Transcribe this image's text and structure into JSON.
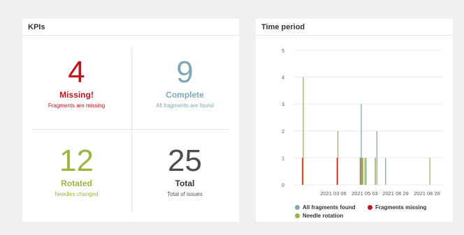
{
  "kpi_panel": {
    "title": "KPIs",
    "cells": [
      {
        "number": "4",
        "label": "Missing!",
        "sub": "Fragments are missing",
        "color": "#c0141e"
      },
      {
        "number": "9",
        "label": "Complete",
        "sub": "All fragments are found",
        "color": "#7fa7b6"
      },
      {
        "number": "12",
        "label": "Rotated",
        "sub": "Needles changed",
        "color": "#9ab642"
      },
      {
        "number": "25",
        "label": "Total",
        "sub": "Total of issues",
        "color": "#4d4d4d"
      }
    ]
  },
  "time_panel": {
    "title": "Time period"
  },
  "chart_data": {
    "type": "bar",
    "title": "",
    "ylim": [
      0,
      5
    ],
    "yticks": [
      "0",
      "1",
      "2",
      "3",
      "4",
      "5"
    ],
    "xticks": [
      "2021 03 06",
      "2021 05 03",
      "2021 06 29",
      "2021 08 26"
    ],
    "grid": true,
    "legend_position": "bottom",
    "series": [
      {
        "name": "All fragments found",
        "color": "#7fa7b6",
        "points": [
          {
            "date": "2021-04-28",
            "value": 3
          },
          {
            "date": "2021-05-07",
            "value": 1
          },
          {
            "date": "2021-05-24",
            "value": 1
          },
          {
            "date": "2021-05-27",
            "value": 2
          },
          {
            "date": "2021-06-12",
            "value": 1
          }
        ]
      },
      {
        "name": "Fragments missing",
        "color": "#c0141e",
        "points": [
          {
            "date": "2021-01-08",
            "value": 1
          },
          {
            "date": "2021-03-13",
            "value": 1
          },
          {
            "date": "2021-04-25",
            "value": 1
          },
          {
            "date": "2021-04-29",
            "value": 1
          }
        ]
      },
      {
        "name": "Needle rotation",
        "color": "#9ab642",
        "points": [
          {
            "date": "2021-01-08",
            "value": 4
          },
          {
            "date": "2021-03-13",
            "value": 2
          },
          {
            "date": "2021-04-23",
            "value": 1
          },
          {
            "date": "2021-04-26",
            "value": 1
          },
          {
            "date": "2021-04-27",
            "value": 1
          },
          {
            "date": "2021-05-02",
            "value": 1
          },
          {
            "date": "2021-05-21",
            "value": 1
          },
          {
            "date": "2021-08-30",
            "value": 1
          }
        ]
      }
    ]
  }
}
